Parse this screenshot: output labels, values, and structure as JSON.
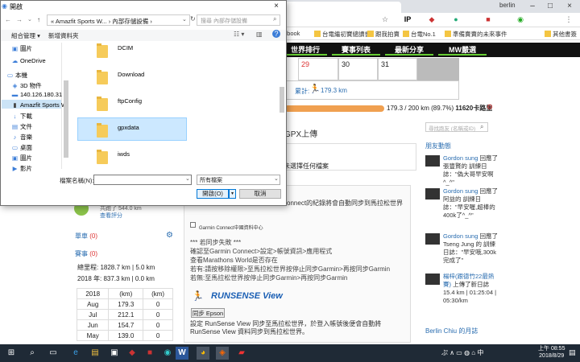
{
  "browser": {
    "user": "berlin",
    "bookmarks": [
      "ebook",
      "台電繼初寶總讀書",
      "跟我拍賣",
      "台電No.1",
      "準備賣賣的未來事件",
      "其他書簽"
    ],
    "nav": [
      "世界排行",
      "賽事列表",
      "最新分享",
      "MW嚴選"
    ],
    "calendar": [
      "29",
      "30",
      "31"
    ],
    "total_label": "累計:",
    "total_value": "179.3 km",
    "progress_text": "179.3 / 200 km (89.7%)",
    "progress_extra": "11620卡路里",
    "gpx_title": "GPX上傳",
    "unselected": "未選擇任何檔案",
    "search_friends": "尋找跑友 (名稱或ID)",
    "friend_head": "朋友動態",
    "feed": [
      {
        "user": "Gordon sung",
        "text": "回應了 張豐賢的 訓練日誌：\"偽大哥早安啊^_^\""
      },
      {
        "user": "Gordon sung",
        "text": "回應了 阿益的 訓練日誌：\"早安喔,超棒的400k了^_^\""
      },
      {
        "user": "Gordon sung",
        "text": "回應了 Tseng Jung 的 訓練日誌：\"早安哦,300k完成了\""
      },
      {
        "user": "楊梓(跟德竹22最熱賽)",
        "text": "上傳了新日誌",
        "extra": "15.4 km | 01:25:04 | 05:30/km"
      }
    ],
    "left_partial": "共跑了 544.0 km",
    "left_more": "查看評分",
    "ride_label": "單車",
    "ride_count": "(0)",
    "race_label": "賽事",
    "race_count": "(0)",
    "stats1": "總里程: 1828.7 km | 5.0 km",
    "stats2": "2018 年: 837.3 km | 0.0 km",
    "month_header": [
      "2018",
      "(km)",
      "(km)"
    ],
    "months": [
      [
        "Aug",
        "179.3",
        "0"
      ],
      [
        "Jul",
        "212.1",
        "0"
      ],
      [
        "Jun",
        "154.7",
        "0"
      ],
      [
        "May",
        "139.0",
        "0"
      ]
    ],
    "gc_text": "Connect帳號後，上傳到Garmin Connect的紀錄將會自動同步到馬拉松世界",
    "gc_check": "Garmin Connect中國資料中心",
    "sync_text": "*** 若同步失敗 ***\n確認至Garmin Connect>設定>帳號資訊>應用程式\n查看Marathons World是否存在\n若有:請按移除權限>至馬拉松世界按停止同步Garmin>再按同步Garmin\n若無:至馬拉松世界按停止同步Garmin>再按同步Garmin",
    "runsense": "RUNSENSE View",
    "sync_epson": "同步 Epson",
    "rs_text": "設定 RunSense View 同步至馬拉松世界，於登入帳號後便會自動將 RunSense View 資料同步到馬拉松世界。",
    "monthly_head": "Berlin Chiu 的月誌"
  },
  "dialog": {
    "title": "開啟",
    "address": "« Amazfit Sports W... › 內部存儲設備 ›",
    "search_placeholder": "搜尋 內部存儲設備",
    "organize": "組合管理 ▾",
    "new_folder": "新增資料夾",
    "nav": [
      "圖片",
      "OneDrive",
      "本機",
      "3D 物件",
      "140.126.180.31",
      "Amazfit Sports W",
      "下載",
      "文件",
      "音樂",
      "桌面",
      "圖片",
      "影片"
    ],
    "folders": [
      "DCIM",
      "Download",
      "ftpConfig",
      "gpxdata",
      "iwds"
    ],
    "filename_label": "檔案名稱(N):",
    "filename_value": "",
    "filetype": "所有檔案",
    "open": "開啟(O)",
    "cancel": "取消"
  },
  "taskbar": {
    "time": "上午 08:55",
    "date": "2018/8/29"
  }
}
